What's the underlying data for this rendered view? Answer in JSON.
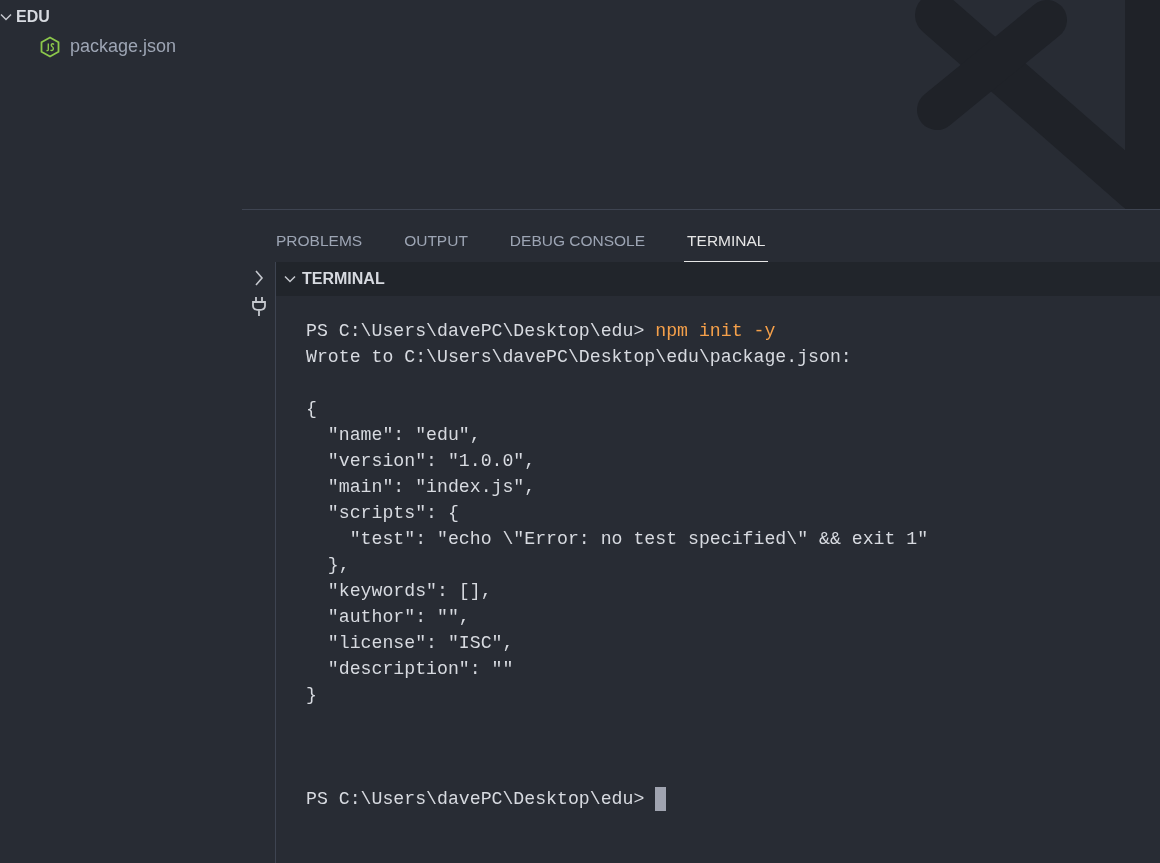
{
  "explorer": {
    "folder": {
      "name": "EDU",
      "expanded": true,
      "children": [
        {
          "name": "package.json"
        }
      ]
    }
  },
  "panel": {
    "tabs": [
      {
        "label": "PROBLEMS",
        "selected": false
      },
      {
        "label": "OUTPUT",
        "selected": false
      },
      {
        "label": "DEBUG CONSOLE",
        "selected": false
      },
      {
        "label": "TERMINAL",
        "selected": true
      }
    ],
    "section": {
      "title": "TERMINAL",
      "expanded": true
    },
    "terminal": {
      "lines": [
        {
          "kind": "command",
          "prompt": "PS C:\\Users\\davePC\\Desktop\\edu>",
          "command": "npm init -y"
        },
        {
          "kind": "output",
          "text": "Wrote to C:\\Users\\davePC\\Desktop\\edu\\package.json:"
        },
        {
          "kind": "blank"
        },
        {
          "kind": "output",
          "text": "{"
        },
        {
          "kind": "output",
          "text": "  \"name\": \"edu\","
        },
        {
          "kind": "output",
          "text": "  \"version\": \"1.0.0\","
        },
        {
          "kind": "output",
          "text": "  \"main\": \"index.js\","
        },
        {
          "kind": "output",
          "text": "  \"scripts\": {"
        },
        {
          "kind": "output",
          "text": "    \"test\": \"echo \\\"Error: no test specified\\\" && exit 1\""
        },
        {
          "kind": "output",
          "text": "  },"
        },
        {
          "kind": "output",
          "text": "  \"keywords\": [],"
        },
        {
          "kind": "output",
          "text": "  \"author\": \"\","
        },
        {
          "kind": "output",
          "text": "  \"license\": \"ISC\","
        },
        {
          "kind": "output",
          "text": "  \"description\": \"\""
        },
        {
          "kind": "output",
          "text": "}"
        },
        {
          "kind": "blank"
        },
        {
          "kind": "blank"
        },
        {
          "kind": "blank"
        },
        {
          "kind": "prompt",
          "prompt": "PS C:\\Users\\davePC\\Desktop\\edu>",
          "cursor": true
        }
      ]
    }
  }
}
